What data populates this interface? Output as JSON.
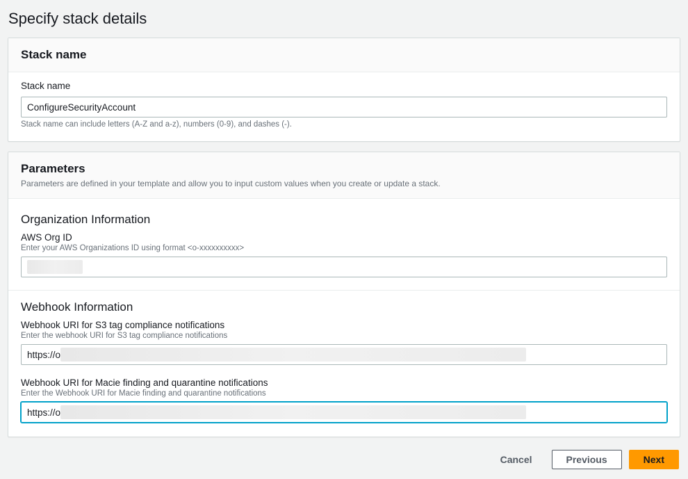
{
  "page": {
    "title": "Specify stack details"
  },
  "stack_name_panel": {
    "heading": "Stack name",
    "label": "Stack name",
    "value": "ConfigureSecurityAccount",
    "hint": "Stack name can include letters (A-Z and a-z), numbers (0-9), and dashes (-)."
  },
  "parameters_panel": {
    "heading": "Parameters",
    "description": "Parameters are defined in your template and allow you to input custom values when you create or update a stack.",
    "org_section": {
      "title": "Organization Information",
      "org_id": {
        "label": "AWS Org ID",
        "desc": "Enter your AWS Organizations ID using format <o-xxxxxxxxxx>",
        "value_redacted": true,
        "value_prefix": ""
      }
    },
    "webhook_section": {
      "title": "Webhook Information",
      "s3": {
        "label": "Webhook URI for S3 tag compliance notifications",
        "desc": "Enter the webhook URI for S3 tag compliance notifications",
        "value_prefix": "https://o",
        "value_redacted": true
      },
      "macie": {
        "label": "Webhook URI for Macie finding and quarantine notifications",
        "desc": "Enter the Webhook URI for Macie finding and quarantine notifications",
        "value_prefix": "https://o",
        "value_redacted": true
      }
    }
  },
  "footer": {
    "cancel": "Cancel",
    "previous": "Previous",
    "next": "Next"
  }
}
